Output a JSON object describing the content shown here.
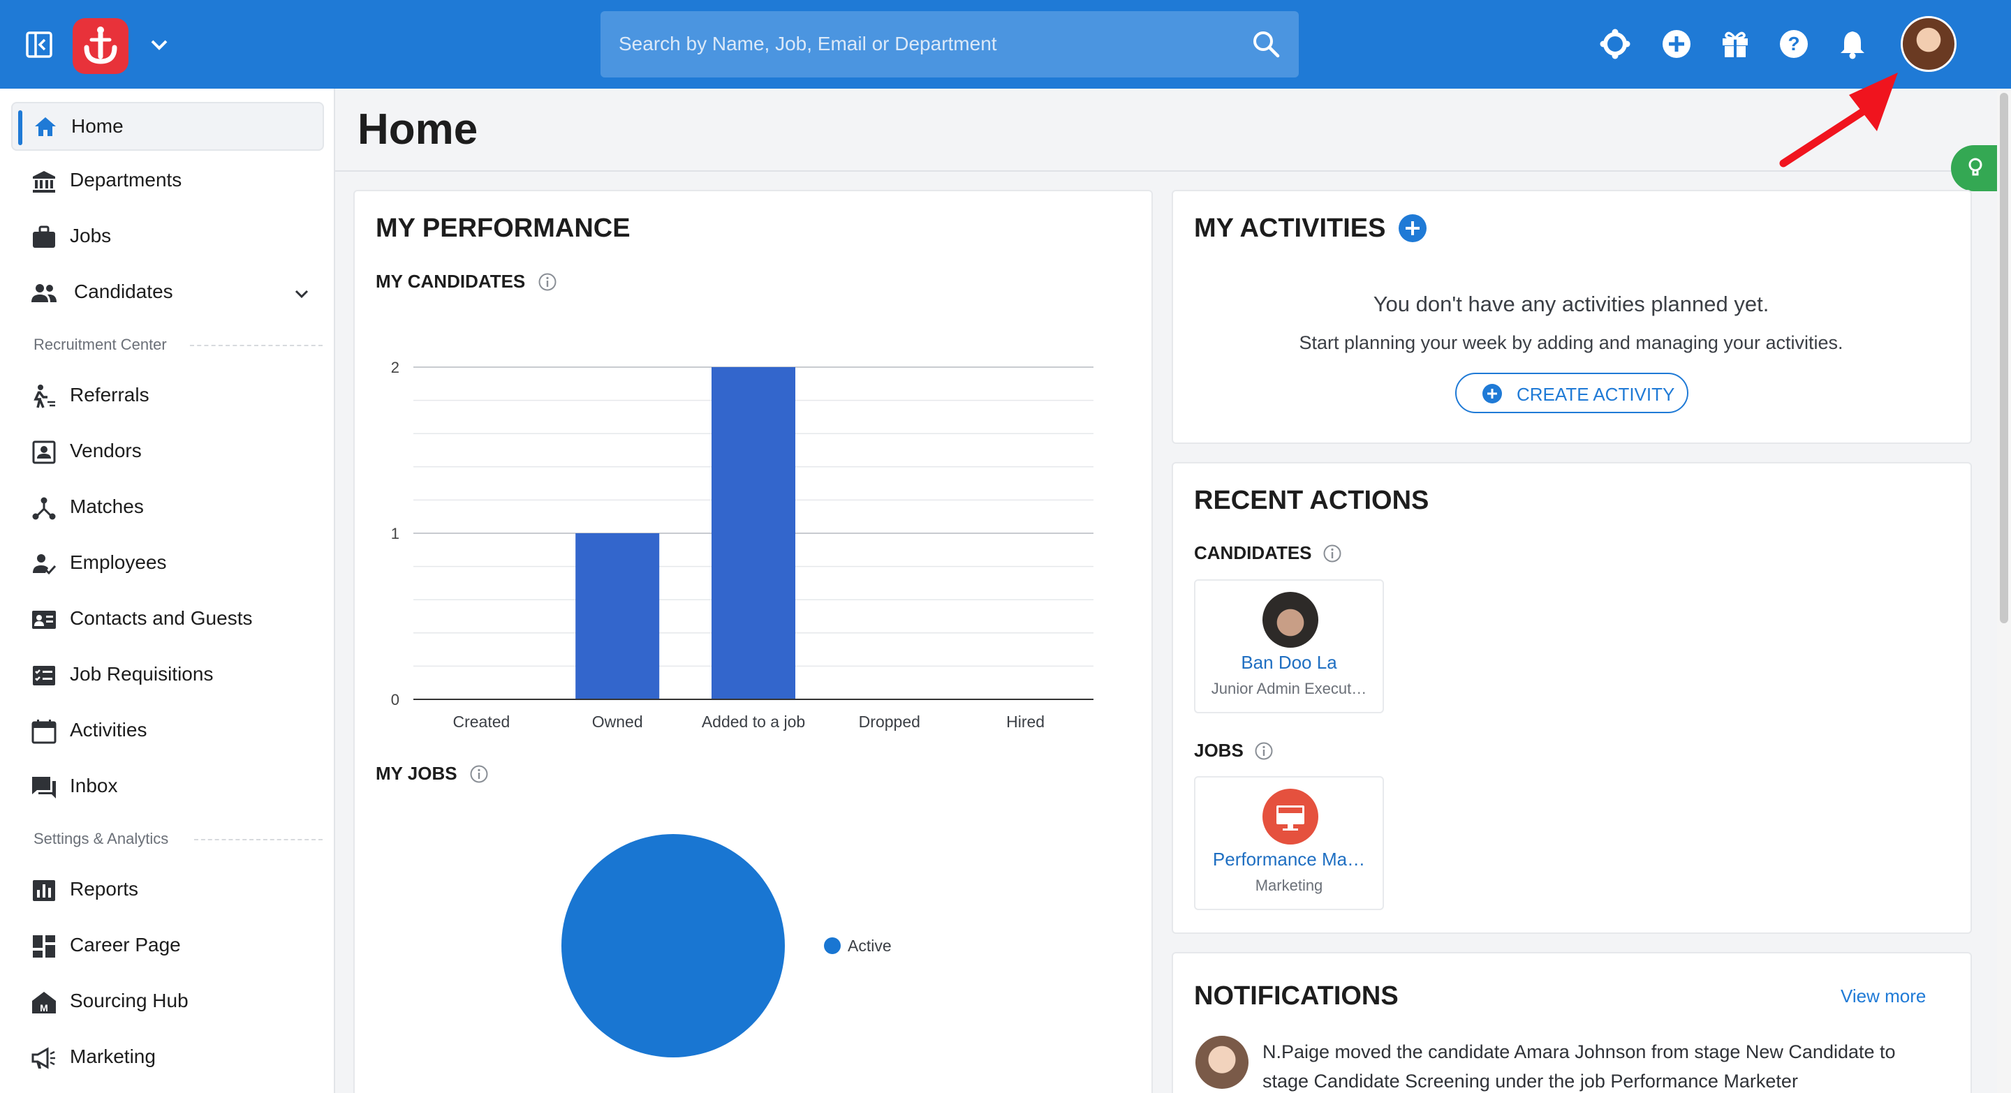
{
  "header": {
    "search_placeholder": "Search by Name, Job, Email or Department",
    "icons": [
      "sidebar-toggle-icon",
      "brand-logo",
      "chevron-down-icon",
      "search-icon",
      "integrations-icon",
      "add-icon",
      "gift-icon",
      "help-icon",
      "bell-icon",
      "user-avatar"
    ]
  },
  "sidebar": {
    "items": [
      {
        "label": "Home",
        "icon": "home-icon",
        "active": true
      },
      {
        "label": "Departments",
        "icon": "bank-icon"
      },
      {
        "label": "Jobs",
        "icon": "briefcase-icon"
      },
      {
        "label": "Candidates",
        "icon": "people-icon",
        "expandable": true
      }
    ],
    "section_recruitment": "Recruitment Center",
    "recruitment_items": [
      {
        "label": "Referrals",
        "icon": "referral-icon"
      },
      {
        "label": "Vendors",
        "icon": "vendor-icon"
      },
      {
        "label": "Matches",
        "icon": "matches-icon"
      },
      {
        "label": "Employees",
        "icon": "employee-icon"
      },
      {
        "label": "Contacts and Guests",
        "icon": "contact-card-icon"
      },
      {
        "label": "Job Requisitions",
        "icon": "requisition-icon"
      },
      {
        "label": "Activities",
        "icon": "calendar-icon"
      },
      {
        "label": "Inbox",
        "icon": "inbox-icon"
      }
    ],
    "section_settings": "Settings & Analytics",
    "settings_items": [
      {
        "label": "Reports",
        "icon": "reports-icon"
      },
      {
        "label": "Career Page",
        "icon": "dashboard-icon"
      },
      {
        "label": "Sourcing Hub",
        "icon": "sourcing-hub-icon"
      },
      {
        "label": "Marketing",
        "icon": "megaphone-icon"
      }
    ]
  },
  "main": {
    "page_title": "Home",
    "performance": {
      "title": "MY PERFORMANCE",
      "candidates_label": "MY CANDIDATES",
      "jobs_label": "MY JOBS"
    },
    "activities": {
      "title": "MY ACTIVITIES",
      "empty_title": "You don't have any activities planned yet.",
      "empty_sub": "Start planning your week by adding and managing your activities.",
      "create_label": "CREATE ACTIVITY"
    },
    "recent_actions": {
      "title": "RECENT ACTIONS",
      "candidates_label": "CANDIDATES",
      "candidate": {
        "name": "Ban Doo La",
        "role": "Junior Admin Execut…"
      },
      "jobs_label": "JOBS",
      "job": {
        "name": "Performance Ma…",
        "department": "Marketing"
      }
    },
    "notifications": {
      "title": "NOTIFICATIONS",
      "view_more": "View more",
      "items": [
        {
          "text": "N.Paige moved the candidate Amara Johnson from stage New Candidate to stage Candidate Screening under the job Performance Marketer"
        }
      ]
    }
  },
  "colors": {
    "brand_blue": "#1f7ad6",
    "logo_red": "#e8323a",
    "bar_blue": "#3366cc",
    "pie_blue": "#1976d2",
    "annotation_red": "#f0141e"
  },
  "chart_data": [
    {
      "type": "bar",
      "title": "MY CANDIDATES",
      "categories": [
        "Created",
        "Owned",
        "Added to a job",
        "Dropped",
        "Hired"
      ],
      "values": [
        0,
        1,
        2,
        0,
        0
      ],
      "ylim": [
        0,
        2
      ],
      "yticks": [
        0,
        1,
        2
      ],
      "grid": true
    },
    {
      "type": "pie",
      "title": "MY JOBS",
      "labels": [
        "Active"
      ],
      "values": [
        1
      ],
      "legend": "right"
    }
  ]
}
